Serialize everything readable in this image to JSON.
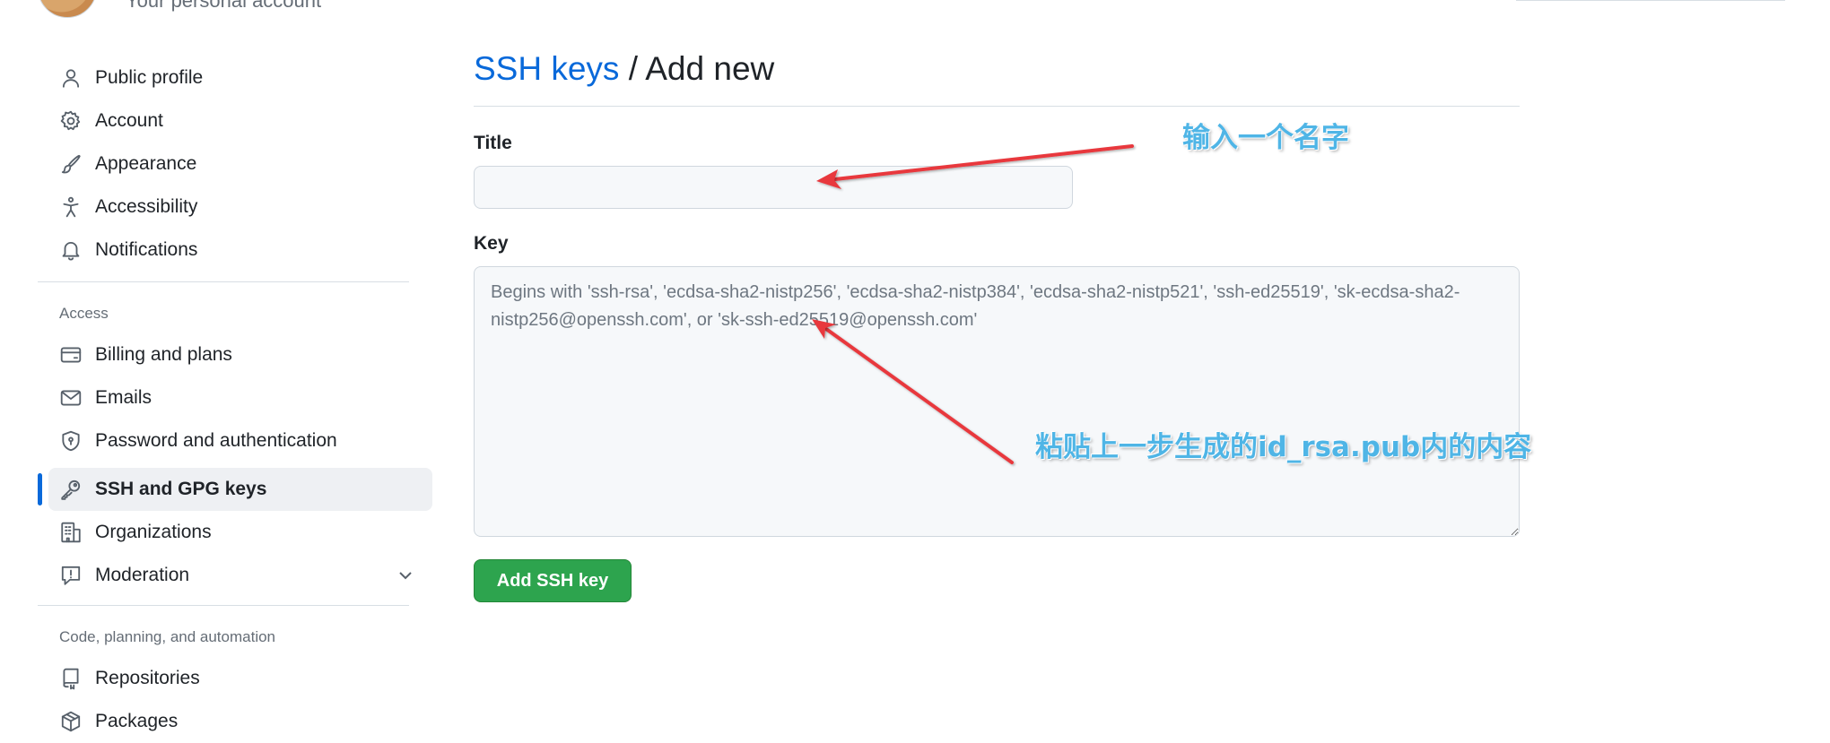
{
  "header": {
    "subtitle": "Your personal account"
  },
  "sidebar": {
    "items_group1": [
      {
        "label": "Public profile",
        "icon": "person-icon"
      },
      {
        "label": "Account",
        "icon": "gear-icon"
      },
      {
        "label": "Appearance",
        "icon": "paintbrush-icon"
      },
      {
        "label": "Accessibility",
        "icon": "accessibility-icon"
      },
      {
        "label": "Notifications",
        "icon": "bell-icon"
      }
    ],
    "section_access": "Access",
    "items_access": [
      {
        "label": "Billing and plans",
        "icon": "credit-card-icon"
      },
      {
        "label": "Emails",
        "icon": "mail-icon"
      },
      {
        "label": "Password and authentication",
        "icon": "shield-lock-icon"
      },
      {
        "label": "SSH and GPG keys",
        "icon": "key-icon",
        "active": true
      },
      {
        "label": "Organizations",
        "icon": "organization-icon"
      },
      {
        "label": "Moderation",
        "icon": "report-icon",
        "expandable": true
      }
    ],
    "section_code": "Code, planning, and automation",
    "items_code": [
      {
        "label": "Repositories",
        "icon": "repo-icon"
      },
      {
        "label": "Packages",
        "icon": "package-icon"
      }
    ]
  },
  "main": {
    "breadcrumb_link": "SSH keys",
    "breadcrumb_sep": " / ",
    "breadcrumb_current": "Add new",
    "title_label": "Title",
    "title_value": "",
    "key_label": "Key",
    "key_placeholder": "Begins with 'ssh-rsa', 'ecdsa-sha2-nistp256', 'ecdsa-sha2-nistp384', 'ecdsa-sha2-nistp521', 'ssh-ed25519', 'sk-ecdsa-sha2-nistp256@openssh.com', or 'sk-ssh-ed25519@openssh.com'",
    "add_button": "Add SSH key"
  },
  "annotations": {
    "title_hint": "输入一个名字",
    "key_hint": "粘贴上一步生成的id_rsa.pub内的内容"
  },
  "colors": {
    "link": "#0969da",
    "button": "#2da44e",
    "annotation_text": "#4fb5e6",
    "annotation_arrow": "#e8383d"
  }
}
